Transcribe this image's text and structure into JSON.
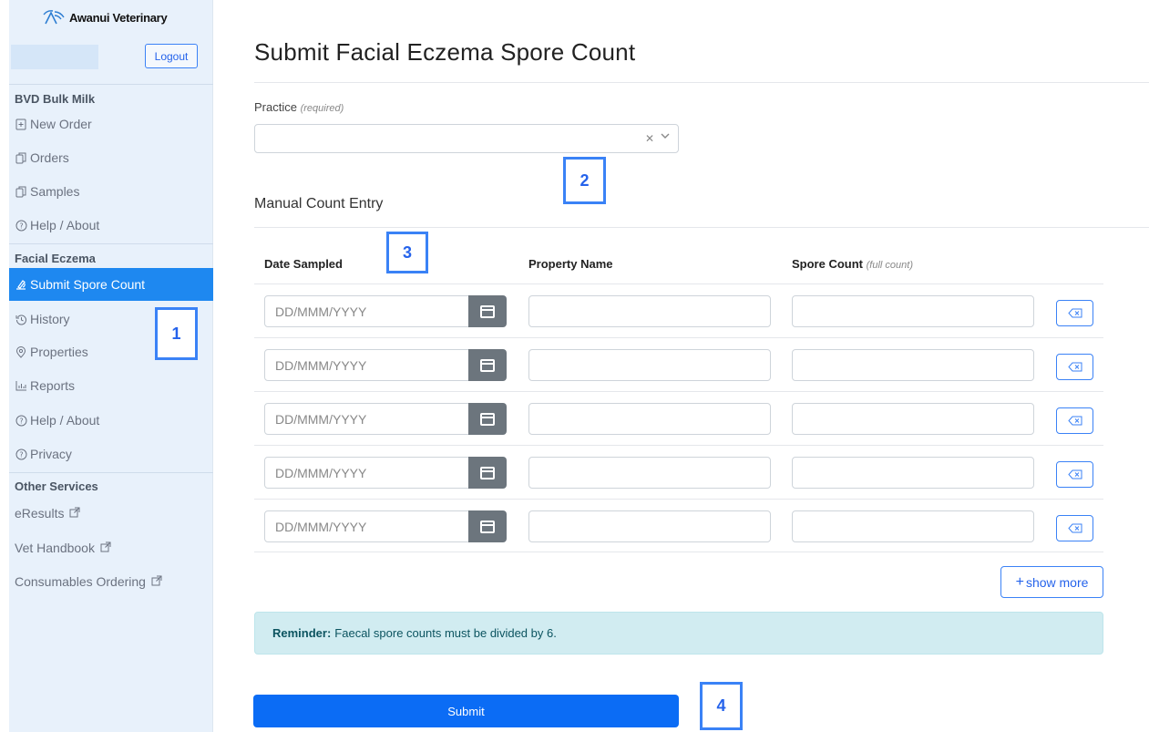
{
  "brand": {
    "name": "Awanui Veterinary",
    "icon": "antenna-wave-icon"
  },
  "sidebar": {
    "logout_label": "Logout",
    "sections": [
      {
        "title": "BVD Bulk Milk",
        "items": [
          {
            "label": "New Order",
            "icon": "file-plus-icon"
          },
          {
            "label": "Orders",
            "icon": "copy-icon"
          },
          {
            "label": "Samples",
            "icon": "copy-icon"
          },
          {
            "label": "Help / About",
            "icon": "question-circle-icon"
          }
        ]
      },
      {
        "title": "Facial Eczema",
        "items": [
          {
            "label": "Submit Spore Count",
            "icon": "microscope-icon",
            "active": true
          },
          {
            "label": "History",
            "icon": "history-icon"
          },
          {
            "label": "Properties",
            "icon": "map-pin-icon"
          },
          {
            "label": "Reports",
            "icon": "bar-chart-icon"
          },
          {
            "label": "Help / About",
            "icon": "question-circle-icon"
          },
          {
            "label": "Privacy",
            "icon": "question-circle-icon"
          }
        ]
      },
      {
        "title": "Other Services",
        "items": [
          {
            "label": "eResults",
            "icon": "external-link-icon"
          },
          {
            "label": "Vet Handbook",
            "icon": "external-link-icon"
          },
          {
            "label": "Consumables Ordering",
            "icon": "external-link-icon"
          }
        ]
      }
    ]
  },
  "main": {
    "title": "Submit Facial Eczema Spore Count",
    "practice": {
      "label": "Practice",
      "hint": "(required)",
      "value": ""
    },
    "manual_title": "Manual Count Entry",
    "table": {
      "headers": {
        "date": "Date Sampled",
        "property": "Property Name",
        "spore": "Spore Count",
        "spore_hint": "(full count)"
      },
      "date_placeholder": "DD/MMM/YYYY",
      "rows": [
        {
          "date": "",
          "property": "",
          "spore": ""
        },
        {
          "date": "",
          "property": "",
          "spore": ""
        },
        {
          "date": "",
          "property": "",
          "spore": ""
        },
        {
          "date": "",
          "property": "",
          "spore": ""
        },
        {
          "date": "",
          "property": "",
          "spore": ""
        }
      ]
    },
    "show_more_label": "show more",
    "reminder": {
      "bold": "Reminder:",
      "text": "Faecal spore counts must be divided by 6."
    },
    "submit_label": "Submit"
  },
  "annotations": [
    "1",
    "2",
    "3",
    "4"
  ],
  "colors": {
    "accent": "#1e88f0",
    "sidebar_bg": "#e8f1fb",
    "submit": "#0b6cf5",
    "reminder_bg": "#d1ecf1",
    "annotation": "#3a82f6"
  }
}
